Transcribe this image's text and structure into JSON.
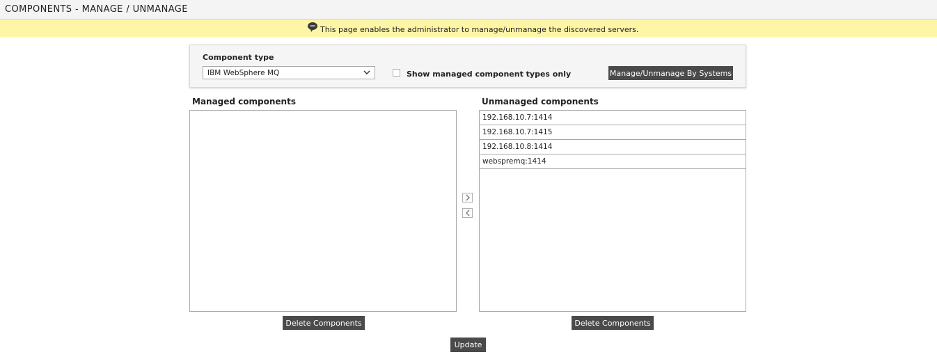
{
  "header": {
    "title": "COMPONENTS - MANAGE / UNMANAGE"
  },
  "info": {
    "icon": "speech-bubble-icon",
    "text": "This page enables the administrator to manage/unmanage the discovered servers."
  },
  "filter": {
    "component_type_label": "Component type",
    "component_type_value": "IBM WebSphere MQ",
    "show_managed_label": "Show managed component types only",
    "show_managed_checked": false,
    "manage_by_systems_label": "Manage/Unmanage By Systems"
  },
  "managed": {
    "title": "Managed components",
    "items": [],
    "delete_label": "Delete Components"
  },
  "unmanaged": {
    "title": "Unmanaged components",
    "items": [
      "192.168.10.7:1414",
      "192.168.10.7:1415",
      "192.168.10.8:1414",
      "webspremq:1414"
    ],
    "delete_label": "Delete Components"
  },
  "update_label": "Update"
}
